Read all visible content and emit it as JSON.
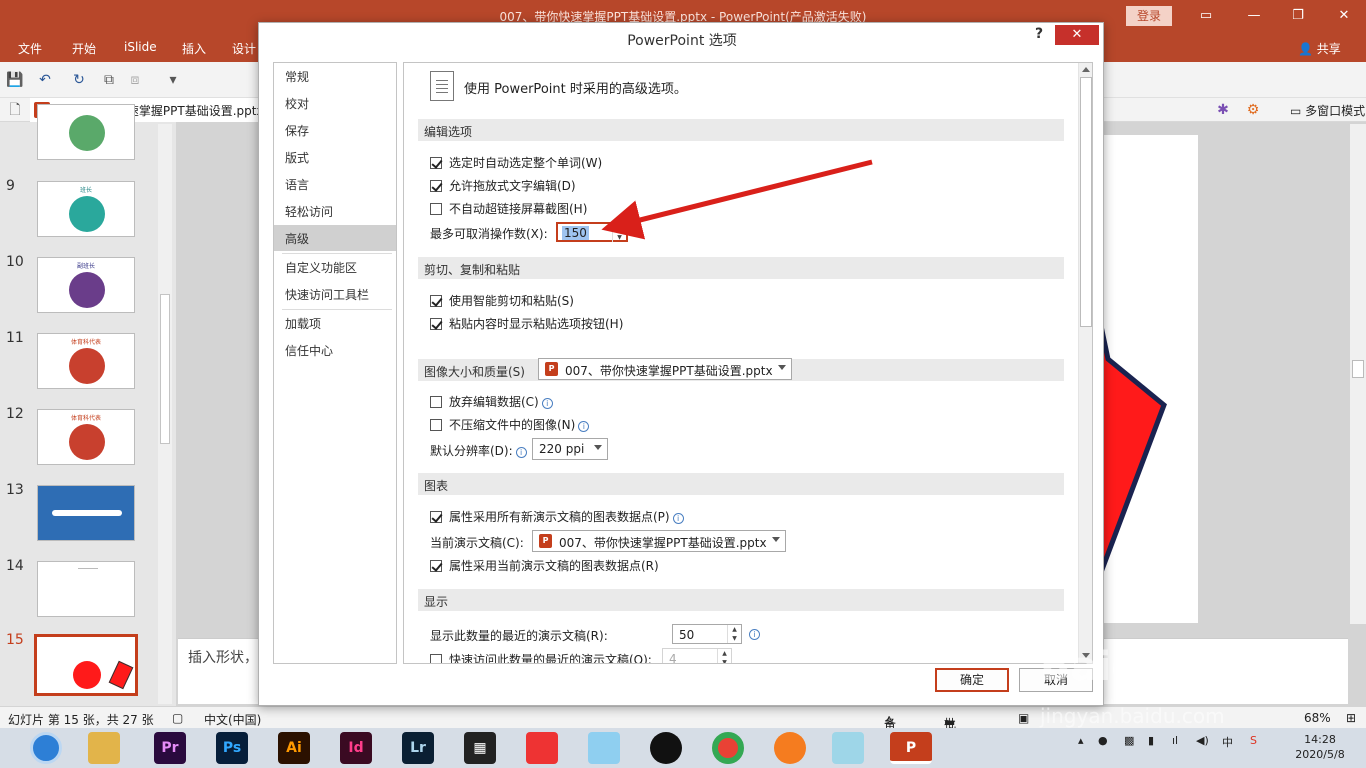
{
  "window": {
    "title": "007、带你快速掌握PPT基础设置.pptx  -  PowerPoint(产品激活失败)",
    "login": "登录",
    "minimize": "—",
    "restore": "❐",
    "close": "✕"
  },
  "ribbon": {
    "tabs": [
      "文件",
      "开始",
      "iSlide",
      "插入",
      "设计"
    ],
    "share": "共享"
  },
  "file_tab": {
    "name": "007、带你快速掌握PPT基础设置.pptx",
    "badge": "P"
  },
  "multi_window": "多窗口模式",
  "slides": [
    {
      "num": "",
      "caption": ""
    },
    {
      "num": "9",
      "caption": "班长"
    },
    {
      "num": "10",
      "caption": "副班长"
    },
    {
      "num": "11",
      "caption": "体育科代表"
    },
    {
      "num": "12",
      "caption": "体育科代表"
    },
    {
      "num": "13",
      "caption": ""
    },
    {
      "num": "14",
      "caption": ""
    },
    {
      "num": "15",
      "caption": ""
    }
  ],
  "notes_text": "插入形状，",
  "status": {
    "slide_info": "幻灯片 第 15 张，共 27 张",
    "language": "中文(中国)",
    "notes": "备注",
    "comments": "批注",
    "zoom": "68%"
  },
  "taskbar": {
    "apps": [
      "Pr",
      "Ps",
      "Ai",
      "Id",
      "Lr"
    ],
    "tray_lang": "中",
    "time": "14:28",
    "date": "2020/5/8"
  },
  "dialog": {
    "title": "PowerPoint 选项",
    "help": "?",
    "close": "✕",
    "nav": [
      "常规",
      "校对",
      "保存",
      "版式",
      "语言",
      "轻松访问",
      "高级",
      "自定义功能区",
      "快速访问工具栏",
      "加载项",
      "信任中心"
    ],
    "active_nav": "高级",
    "intro": "使用 PowerPoint 时采用的高级选项。",
    "sections": {
      "edit": "编辑选项",
      "clipboard": "剪切、复制和粘贴",
      "image": "图像大小和质量(S)",
      "chart": "图表",
      "display": "显示"
    },
    "options": {
      "select_word": "选定时自动选定整个单词(W)",
      "drag_drop": "允许拖放式文字编辑(D)",
      "no_hyperlink": "不自动超链接屏幕截图(H)",
      "undo_label": "最多可取消操作数(X):",
      "undo_value": "150",
      "smart_cut": "使用智能剪切和粘贴(S)",
      "paste_options": "粘贴内容时显示粘贴选项按钮(H)",
      "image_file": "007、带你快速掌握PPT基础设置.pptx",
      "discard_edit": "放弃编辑数据(C)",
      "no_compress": "不压缩文件中的图像(N)",
      "resolution_label": "默认分辨率(D):",
      "resolution_value": "220 ppi",
      "chart_all": "属性采用所有新演示文稿的图表数据点(P)",
      "current_doc_label": "当前演示文稿(C):",
      "current_doc_file": "007、带你快速掌握PPT基础设置.pptx",
      "chart_current": "属性采用当前演示文稿的图表数据点(R)",
      "recent_label": "显示此数量的最近的演示文稿(R):",
      "recent_value": "50",
      "quick_recent": "快速访问此数量的最近的演示文稿(Q):",
      "quick_recent_value": "4"
    },
    "ok": "确定",
    "cancel": "取消"
  },
  "watermark": {
    "brand": "Baidu经验",
    "url": "jingyan.baidu.com"
  },
  "colors": {
    "accent": "#b7472a",
    "annotation_arrow": "#d9201a",
    "shape_red": "#ff1a1a"
  }
}
